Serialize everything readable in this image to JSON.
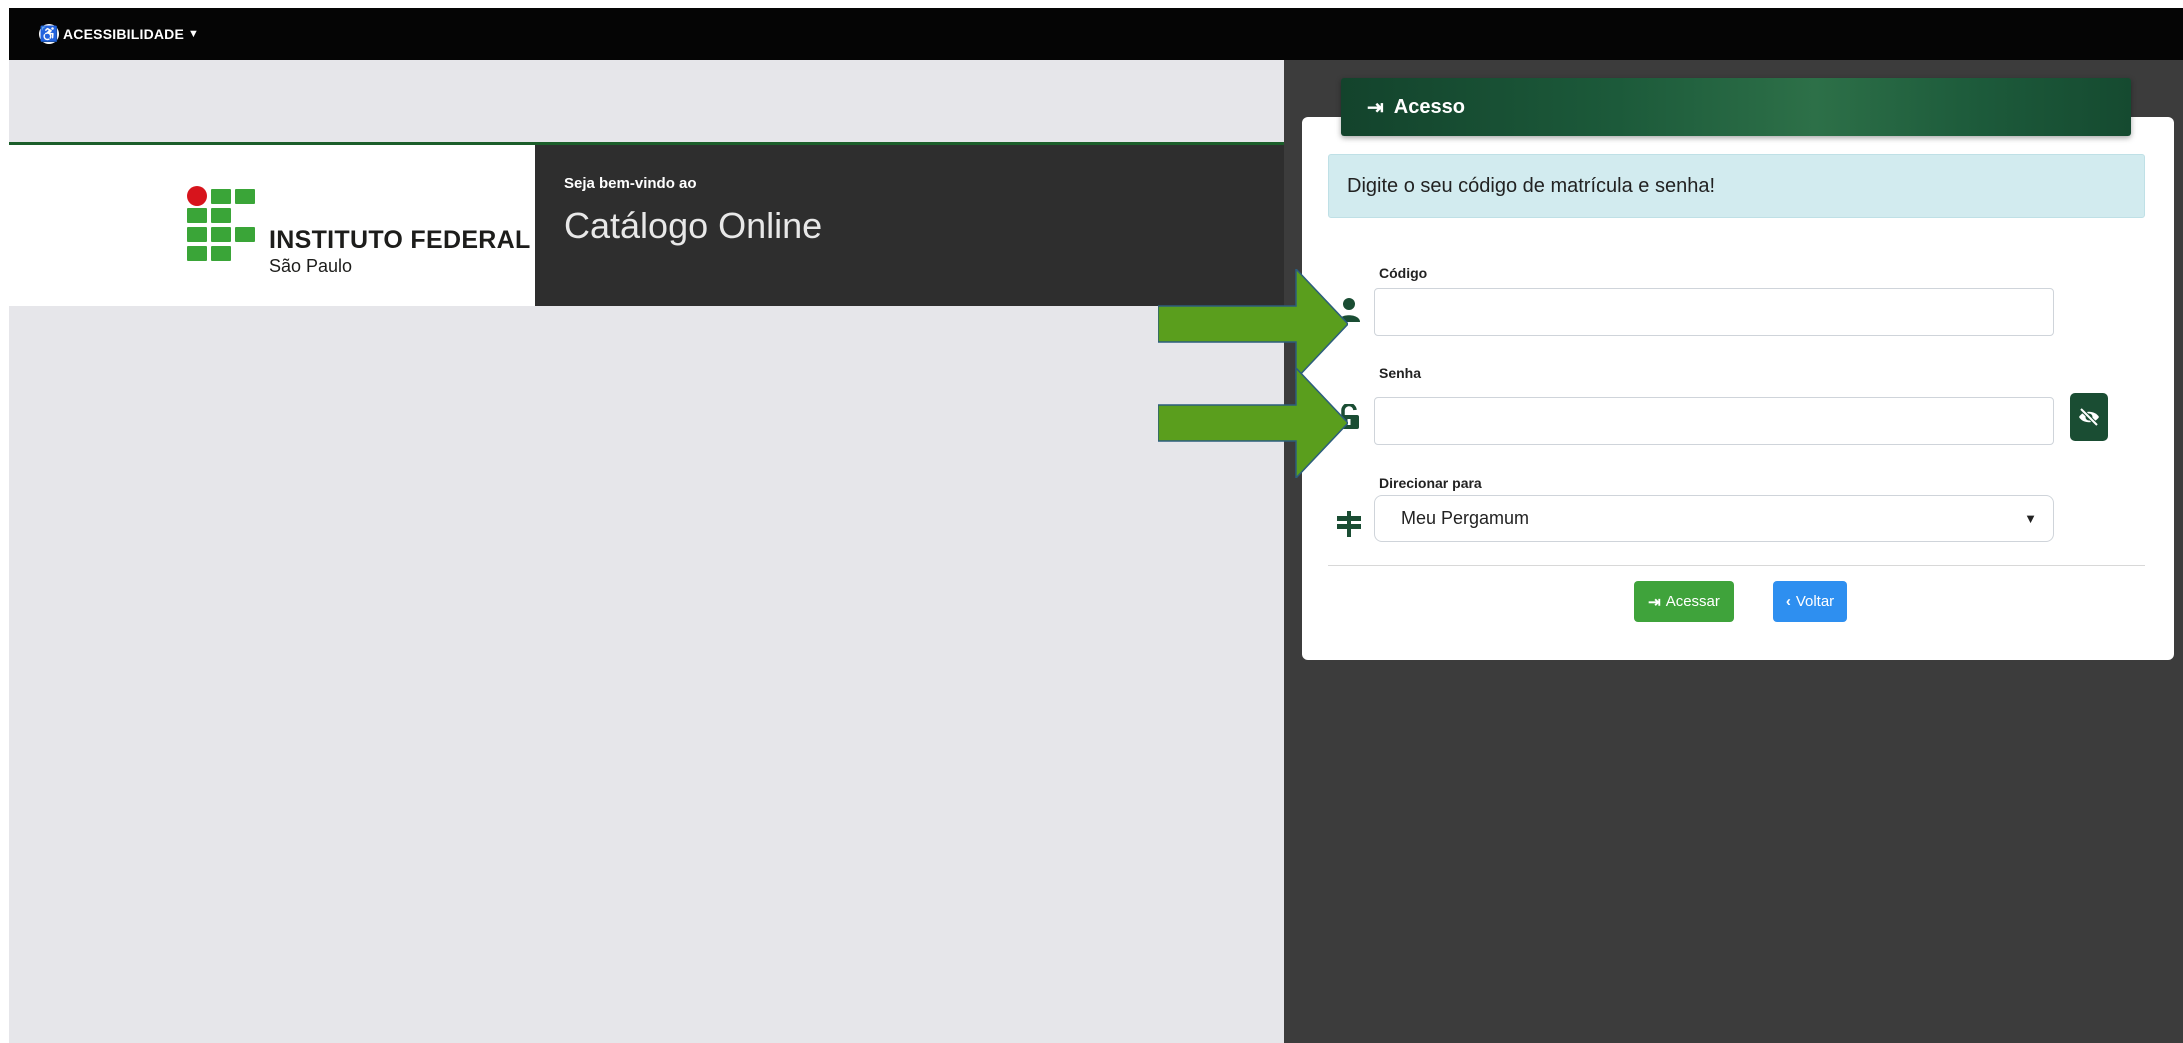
{
  "topbar": {
    "accessibility_label": "ACESSIBILIDADE",
    "accessibility_icon": "accessibility-icon",
    "chevron_icon": "chevron-down-icon"
  },
  "banner": {
    "logo_title": "INSTITUTO FEDERAL",
    "logo_subtitle": "São Paulo",
    "welcome_small": "Seja bem-vindo ao",
    "welcome_big": "Catálogo Online"
  },
  "login": {
    "header_title": "Acesso",
    "alert_text": "Digite o seu código de matrícula e senha!",
    "codigo_label": "Código",
    "codigo_value": "",
    "senha_label": "Senha",
    "senha_value": "",
    "direcionar_label": "Direcionar para",
    "direcionar_selected": "Meu Pergamum",
    "acessar_label": "Acessar",
    "voltar_label": "Voltar"
  },
  "colors": {
    "topbar": "#050505",
    "left_bg": "#e6e6ea",
    "right_bg": "#3c3c3c",
    "header_green": "#1c5a3a",
    "acessar_green": "#3fa33b",
    "voltar_blue": "#2e8ff0",
    "alert_bg": "#d2ebef",
    "arrow_green": "#5a9e1d",
    "if_green": "#3aa538",
    "if_red": "#d7141c"
  },
  "icons": {
    "header": "sign-in-icon",
    "codigo": "user-icon",
    "senha": "unlock-icon",
    "direcionar": "signpost-icon",
    "toggle_password": "eye-slash-icon",
    "acessar": "sign-in-icon",
    "voltar": "chevron-left-icon"
  }
}
